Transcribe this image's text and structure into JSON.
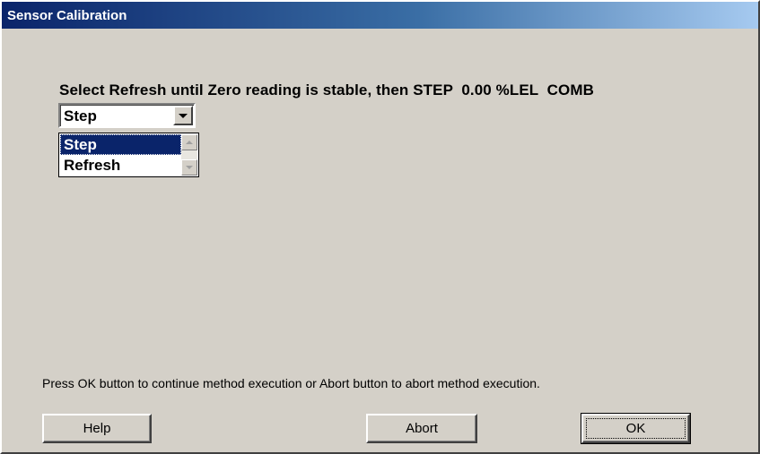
{
  "window": {
    "title": "Sensor Calibration"
  },
  "instruction": {
    "text": "Select Refresh until Zero reading is stable, then STEP  0.00 %LEL  COMB"
  },
  "combo": {
    "selected": "Step",
    "options": [
      "Step",
      "Refresh"
    ]
  },
  "listbox": {
    "items": [
      {
        "label": "Step",
        "selected": true
      },
      {
        "label": "Refresh",
        "selected": false
      }
    ]
  },
  "footer": {
    "message": "Press OK button to continue method execution or Abort button to abort method execution."
  },
  "buttons": {
    "help": "Help",
    "abort": "Abort",
    "ok": "OK"
  },
  "colors": {
    "titlebar_start": "#0a246a",
    "titlebar_end": "#a6caf0",
    "dialog_bg": "#d4d0c8",
    "selection": "#0a246a"
  },
  "icons": {
    "combo_button": "chevron-down-icon",
    "scroll_up": "chevron-up-icon",
    "scroll_down": "chevron-down-icon"
  }
}
